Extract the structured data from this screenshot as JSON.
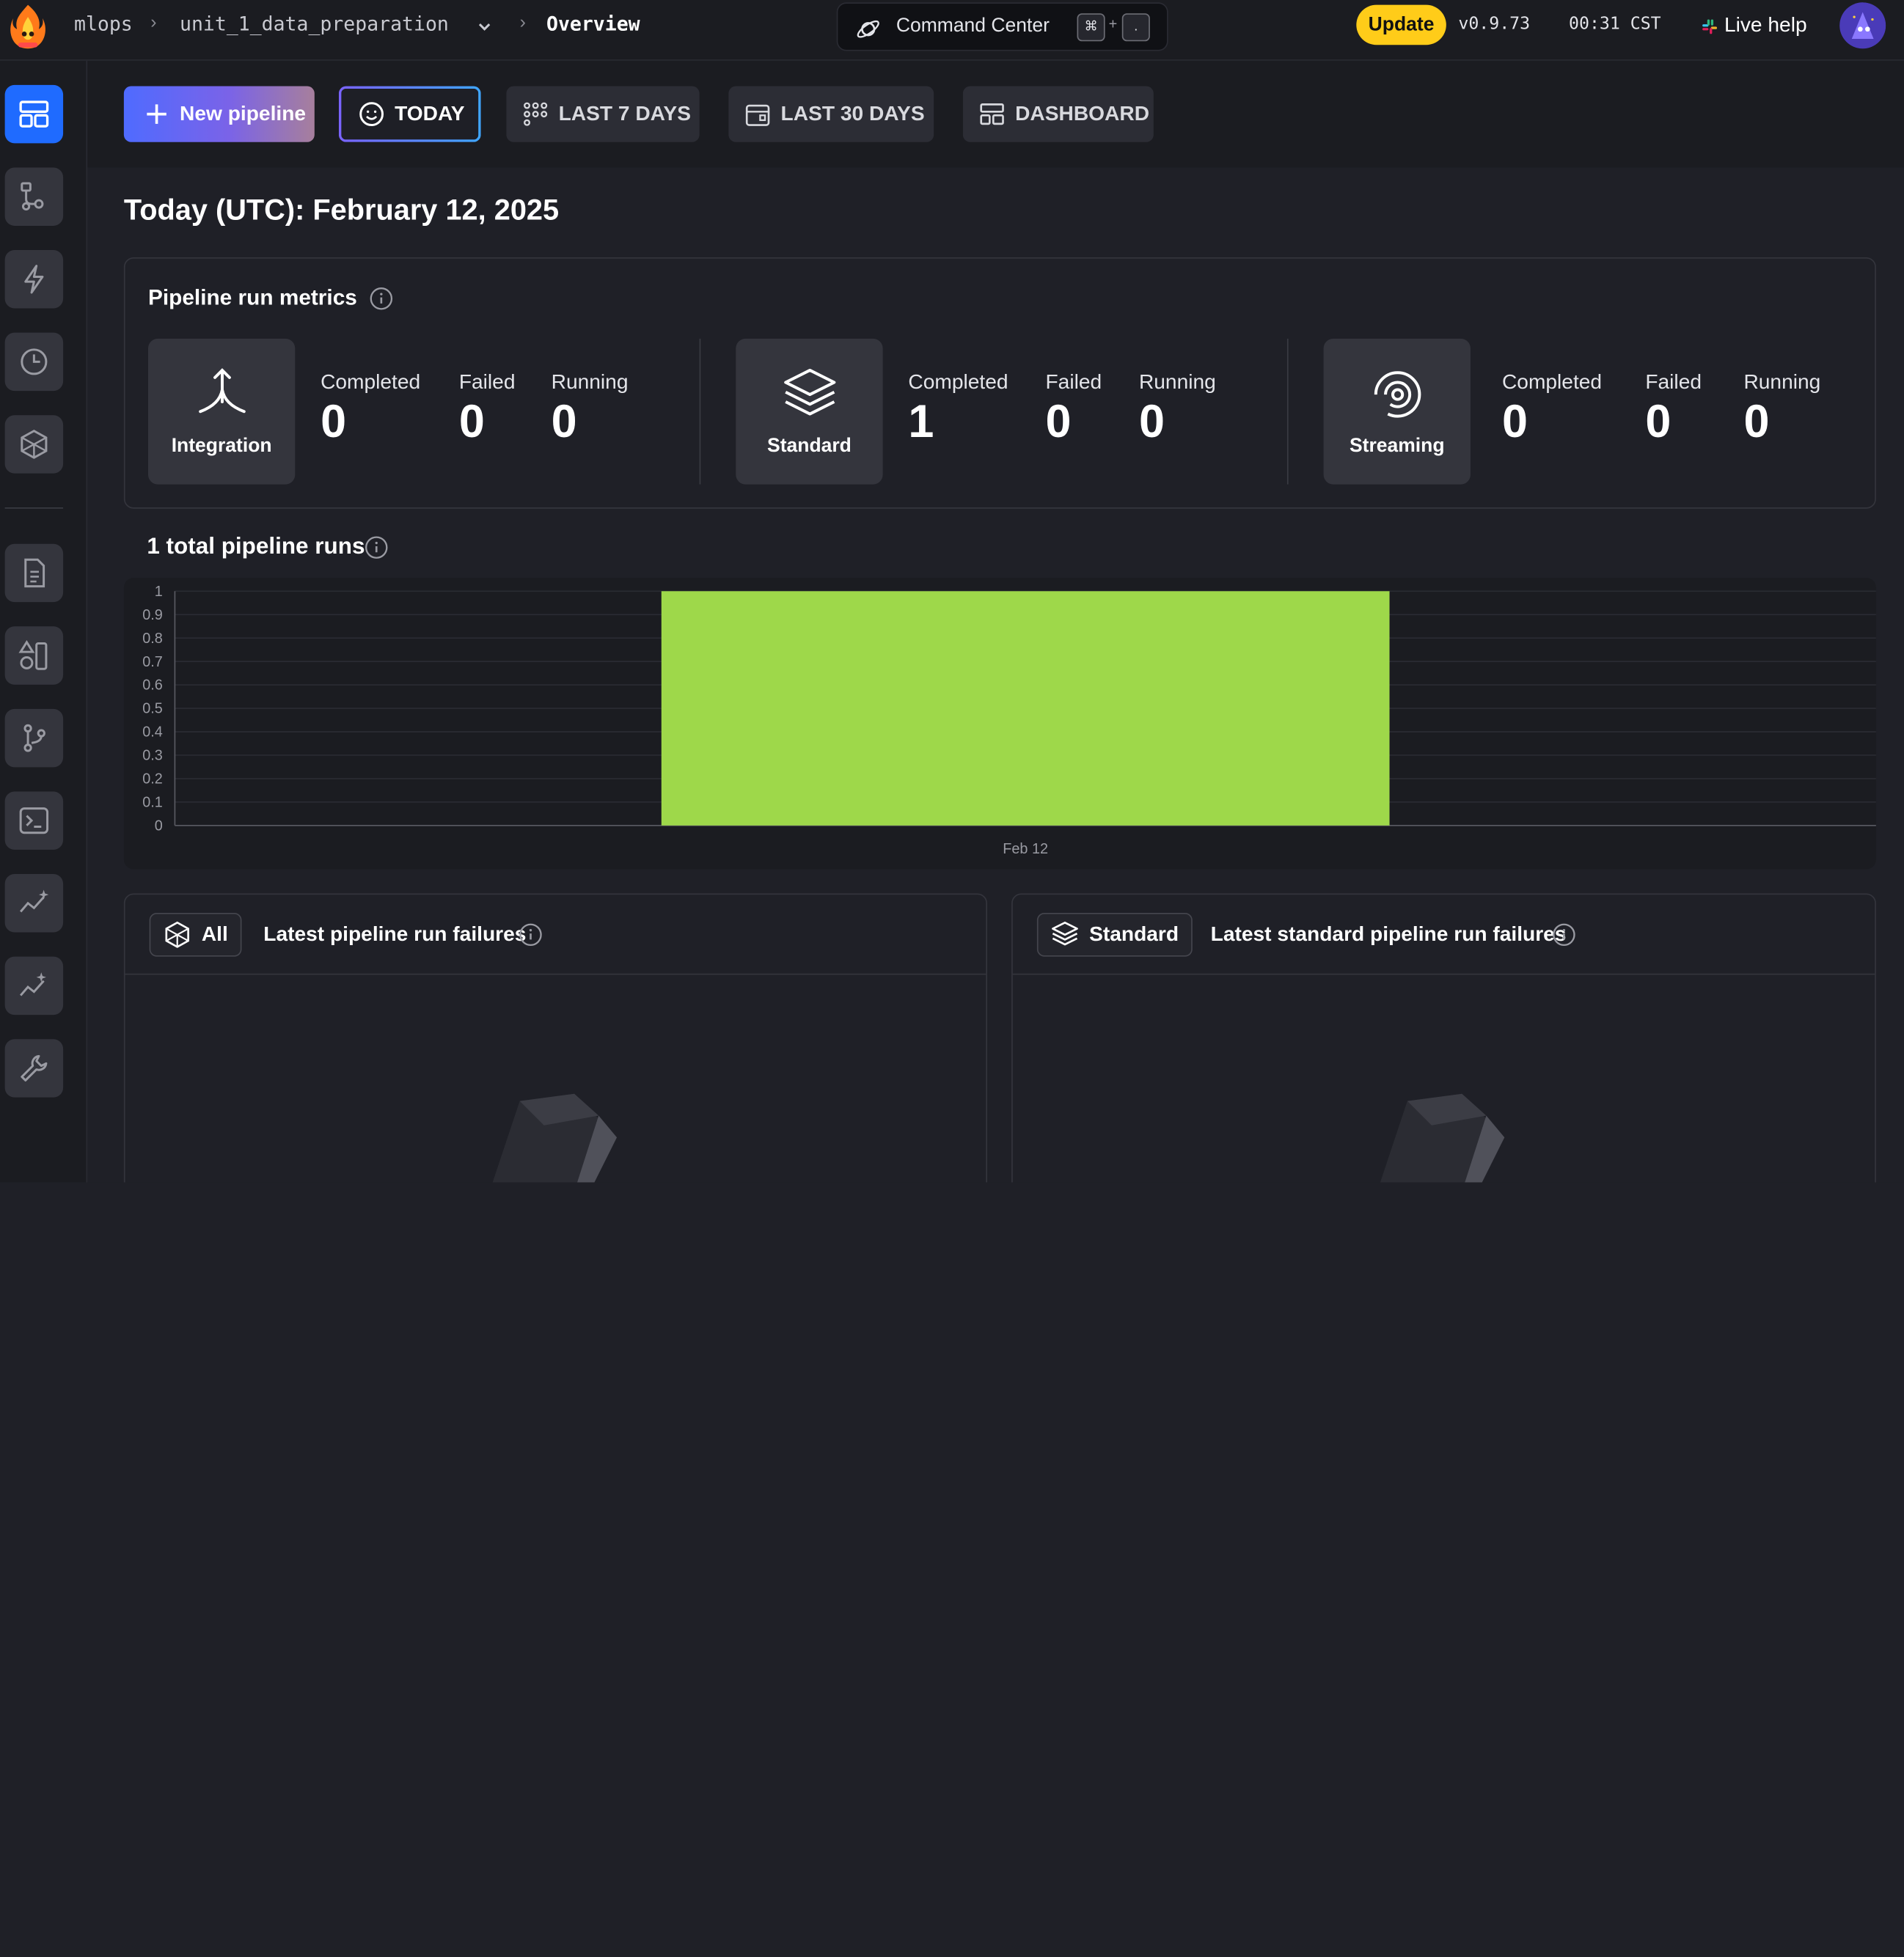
{
  "header": {
    "breadcrumbs": [
      "mlops",
      "unit_1_data_preparation",
      "Overview"
    ],
    "command_center": {
      "label": "Command Center",
      "keys": [
        "⌘",
        "+",
        "."
      ]
    },
    "update_label": "Update",
    "version": "v0.9.73",
    "time": "00:31 CST",
    "live_help": "Live help"
  },
  "sidebar": {
    "items": [
      "overview-icon",
      "pipelines-icon",
      "triggers-icon",
      "runs-icon",
      "blocks-icon",
      "files-icon",
      "templates-icon",
      "version-control-icon",
      "terminal-icon",
      "monitoring-icon",
      "insights-icon",
      "settings-icon"
    ]
  },
  "toolbar": {
    "new_pipeline": "New pipeline",
    "today": "TODAY",
    "last_7_days": "LAST 7 DAYS",
    "last_30_days": "LAST 30 DAYS",
    "dashboard": "DASHBOARD"
  },
  "page_title": "Today (UTC): February 12, 2025",
  "metrics": {
    "title": "Pipeline run metrics",
    "groups": [
      {
        "type": "Integration",
        "stats": [
          {
            "label": "Completed",
            "value": "0"
          },
          {
            "label": "Failed",
            "value": "0"
          },
          {
            "label": "Running",
            "value": "0"
          }
        ]
      },
      {
        "type": "Standard",
        "stats": [
          {
            "label": "Completed",
            "value": "1"
          },
          {
            "label": "Failed",
            "value": "0"
          },
          {
            "label": "Running",
            "value": "0"
          }
        ]
      },
      {
        "type": "Streaming",
        "stats": [
          {
            "label": "Completed",
            "value": "0"
          },
          {
            "label": "Failed",
            "value": "0"
          },
          {
            "label": "Running",
            "value": "0"
          }
        ]
      }
    ]
  },
  "runs": {
    "title": "1 total pipeline runs"
  },
  "chart_data": {
    "type": "bar",
    "categories": [
      "Feb 12"
    ],
    "values": [
      1
    ],
    "ylim": [
      0,
      1
    ],
    "yticks": [
      "0",
      "0.1",
      "0.2",
      "0.3",
      "0.4",
      "0.5",
      "0.6",
      "0.7",
      "0.8",
      "0.9",
      "1"
    ],
    "color": "#9ed84a",
    "grid": true
  },
  "failures": {
    "all_chip": "All",
    "all_title": "Latest pipeline run failures",
    "standard_chip": "Standard",
    "standard_title": "Latest standard pipeline run failures"
  },
  "colors": {
    "accent_blue": "#1f6bff",
    "update_yellow": "#ffcc19",
    "bar_green": "#9ed84a"
  }
}
